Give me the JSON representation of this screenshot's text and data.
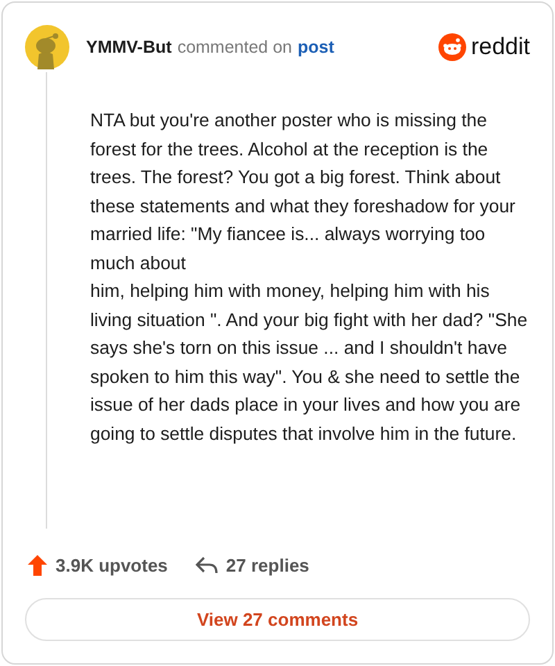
{
  "header": {
    "username": "YMMV-But",
    "action": "commented on",
    "link": "post",
    "logo_text": "reddit"
  },
  "comment": {
    "body": "NTA but you're another poster who is missing the forest for the trees. Alcohol at the reception is the trees. The forest? You got a big forest. Think about these statements and what they foreshadow for your married life: \"My fiancee is... always worrying too much about\nhim, helping him with money, helping him with his living situation \". And your big fight with her dad? \"She says she's torn on this issue ... and I shouldn't have\nspoken to him this way\". You & she need to settle the issue of her dads place in your lives and how you are going to settle disputes that involve him in the future."
  },
  "footer": {
    "upvotes": "3.9K upvotes",
    "replies": "27 replies",
    "button": "View 27 comments"
  }
}
